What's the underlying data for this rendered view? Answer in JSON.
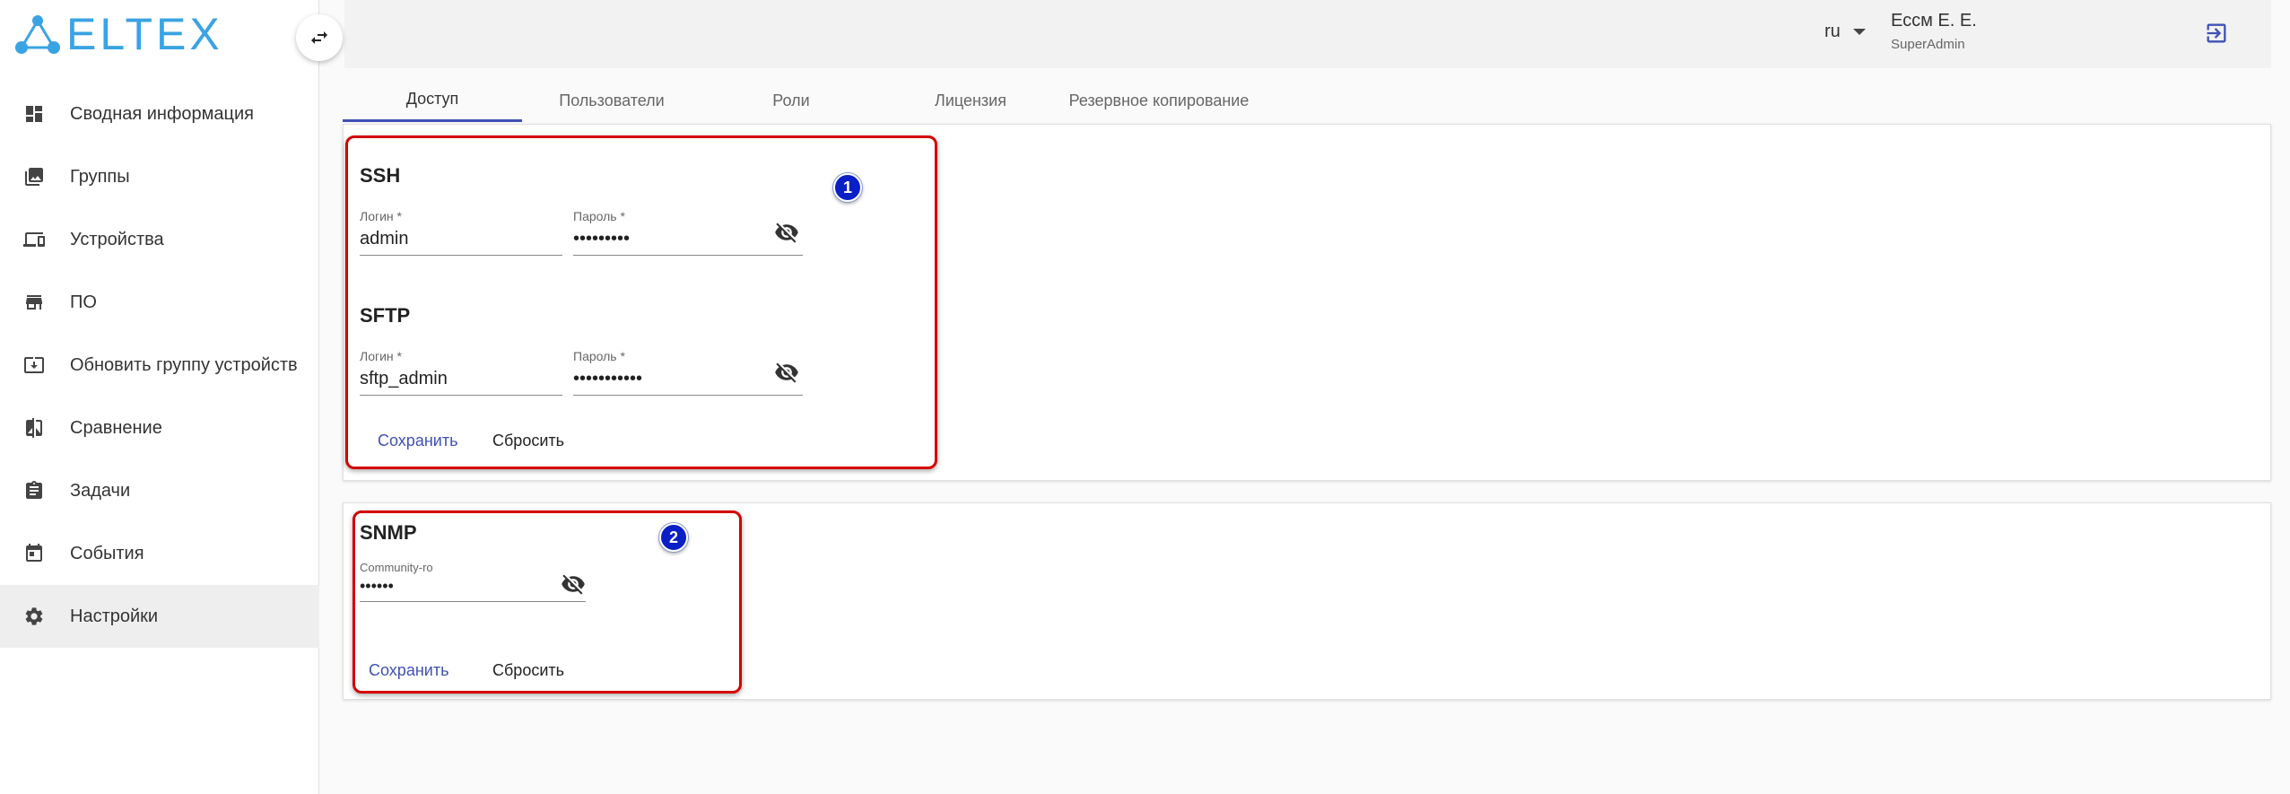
{
  "app": {
    "logo_text": "ELTEX"
  },
  "sidebar": {
    "items": [
      {
        "label": "Сводная информация",
        "icon": "dashboard-icon"
      },
      {
        "label": "Группы",
        "icon": "photo-library-icon"
      },
      {
        "label": "Устройства",
        "icon": "devices-icon"
      },
      {
        "label": "ПО",
        "icon": "store-icon"
      },
      {
        "label": "Обновить группу устройств",
        "icon": "system-update-icon"
      },
      {
        "label": "Сравнение",
        "icon": "compare-icon"
      },
      {
        "label": "Задачи",
        "icon": "assignment-icon"
      },
      {
        "label": "События",
        "icon": "event-icon"
      },
      {
        "label": "Настройки",
        "icon": "gear-icon",
        "active": true
      }
    ]
  },
  "header": {
    "language": "ru",
    "user_name": "Ессм Е. Е.",
    "user_role": "SuperAdmin"
  },
  "tabs": [
    {
      "label": "Доступ",
      "active": true
    },
    {
      "label": "Пользователи"
    },
    {
      "label": "Роли"
    },
    {
      "label": "Лицензия"
    },
    {
      "label": "Резервное копирование"
    }
  ],
  "access": {
    "ssh": {
      "title": "SSH",
      "login_label": "Логин *",
      "login_value": "admin",
      "password_label": "Пароль *",
      "password_value": "•••••••••"
    },
    "sftp": {
      "title": "SFTP",
      "login_label": "Логин *",
      "login_value": "sftp_admin",
      "password_label": "Пароль *",
      "password_value": "•••••••••••"
    },
    "save_label": "Сохранить",
    "reset_label": "Сбросить",
    "badge": "1"
  },
  "snmp": {
    "title": "SNMP",
    "community_label": "Community-ro",
    "community_value": "••••••",
    "save_label": "Сохранить",
    "reset_label": "Сбросить",
    "badge": "2"
  },
  "colors": {
    "accent": "#3f51b5",
    "logo": "#3aa3e3",
    "highlight": "#d40000",
    "badge": "#0b1fc7"
  }
}
